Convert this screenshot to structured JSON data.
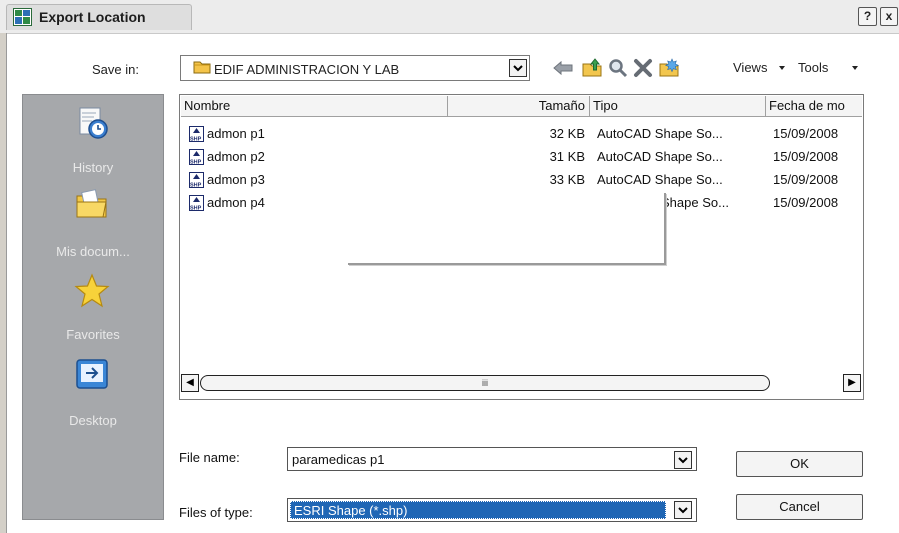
{
  "window": {
    "title": "Export Location",
    "help_button": "?",
    "close_button": "x"
  },
  "toolbar": {
    "save_in_label": "Save in:",
    "save_in_value": "EDIF ADMINISTRACION Y LAB",
    "icons": [
      "back-arrow-icon",
      "up-folder-icon",
      "search-web-icon",
      "delete-icon",
      "new-folder-icon"
    ],
    "views_label": "Views",
    "tools_label": "Tools"
  },
  "places": [
    {
      "label": "History",
      "icon": "history-icon"
    },
    {
      "label": "Mis docum...",
      "icon": "my-documents-icon"
    },
    {
      "label": "Favorites",
      "icon": "favorites-star-icon"
    },
    {
      "label": "Desktop",
      "icon": "desktop-icon"
    }
  ],
  "file_list": {
    "columns": [
      "Nombre",
      "Tamaño",
      "Tipo",
      "Fecha de mo"
    ],
    "rows": [
      {
        "name": "admon p1",
        "size": "32 KB",
        "type": "AutoCAD Shape So...",
        "date": "15/09/2008"
      },
      {
        "name": "admon p2",
        "size": "31 KB",
        "type": "AutoCAD Shape So...",
        "date": "15/09/2008"
      },
      {
        "name": "admon p3",
        "size": "33 KB",
        "type": "AutoCAD Shape So...",
        "date": "15/09/2008"
      },
      {
        "name": "admon p4",
        "size": "",
        "type": "Shape So...",
        "date": "15/09/2008"
      }
    ],
    "scroll_thumb_grip": "iii"
  },
  "bottom": {
    "file_name_label": "File name:",
    "file_name_value": "paramedicas p1",
    "file_type_label": "Files of type:",
    "file_type_value": "ESRI Shape (*.shp)",
    "ok_label": "OK",
    "cancel_label": "Cancel"
  },
  "colors": {
    "places_bg": "#a6a8ab",
    "selection": "#1f66b5"
  }
}
